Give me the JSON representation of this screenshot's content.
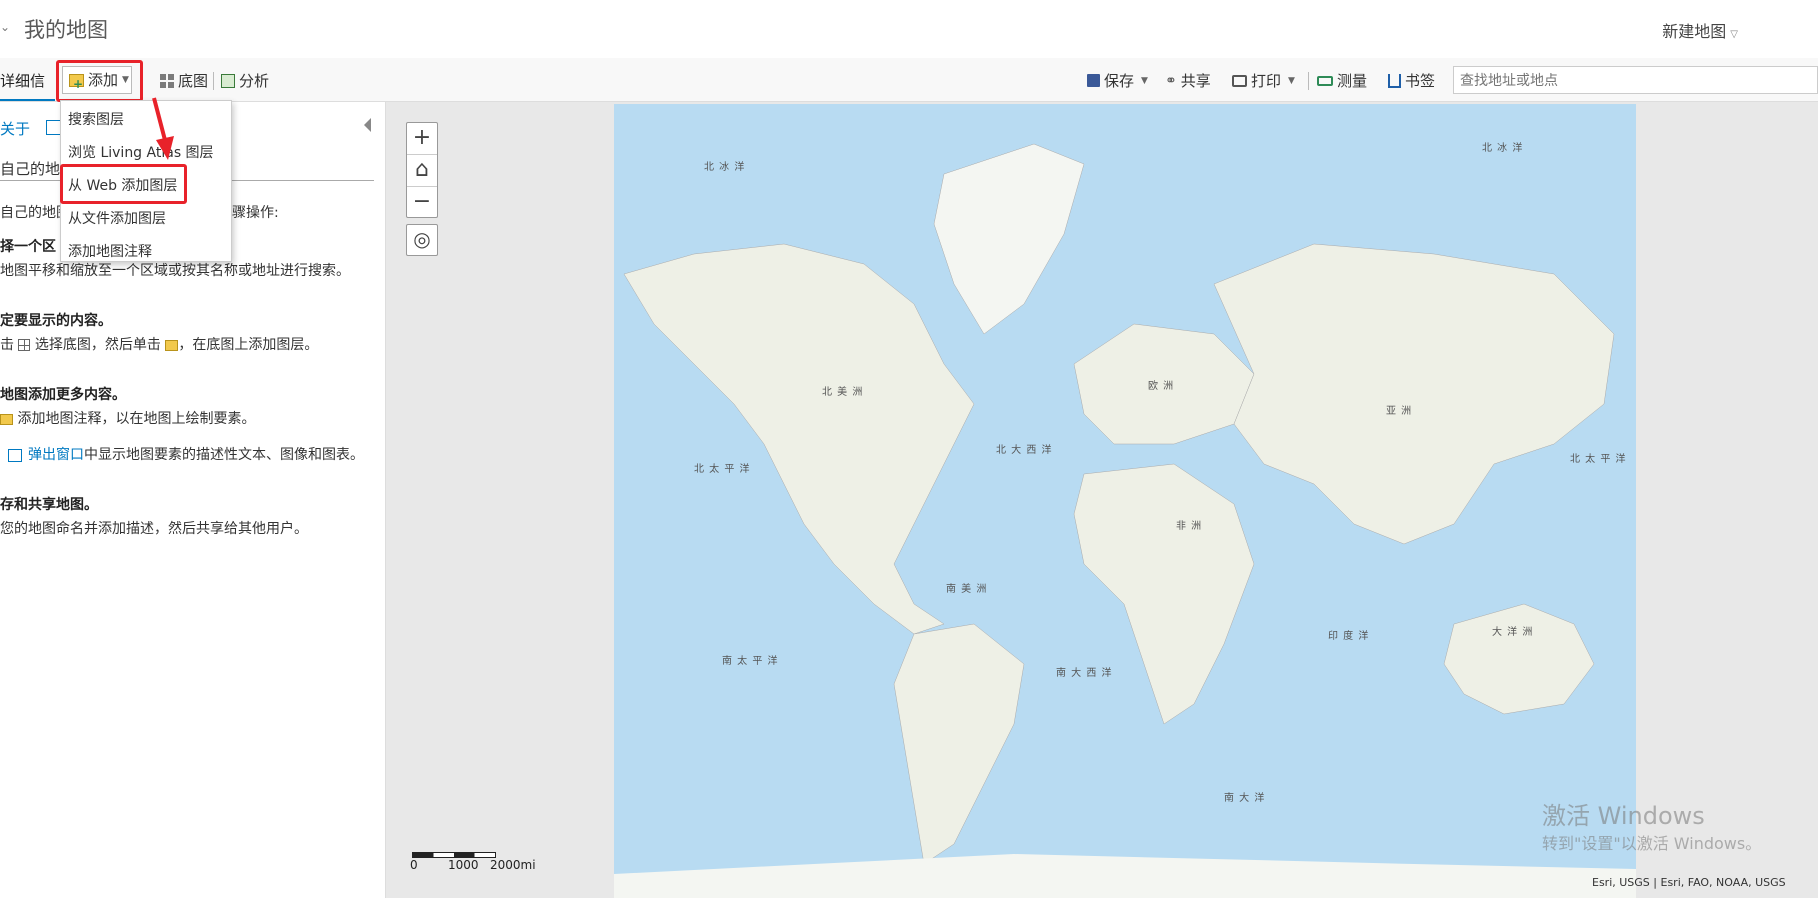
{
  "header": {
    "title": "我的地图",
    "new_map": "新建地图"
  },
  "toolbar": {
    "details_tab": "详细信息",
    "add": "添加",
    "basemap": "底图",
    "analysis": "分析",
    "save": "保存",
    "share": "共享",
    "print": "打印",
    "measure": "测量",
    "bookmarks": "书签",
    "search_placeholder": "查找地址或地点"
  },
  "add_menu": {
    "items": [
      "搜索图层",
      "浏览 Living Atlas 图层",
      "从 Web 添加图层",
      "从文件添加图层",
      "添加地图注释"
    ]
  },
  "panel": {
    "about": "关于",
    "subtitle": "自己的地图",
    "intro": "自己的地图",
    "intro_tail": "骤操作:",
    "step1_title": "择一个区",
    "step1_text": "地图平移和缩放至一个区域或按其名称或地址进行搜索。",
    "step2_title": "定要显示的内容。",
    "step2_text_a": "击",
    "step2_text_b": "选择底图，然后单击",
    "step2_text_c": "，在底图上添加图层。",
    "step3_title": "地图添加更多内容。",
    "step3_text": "添加地图注释，以在地图上绘制要素。",
    "step3_link": "弹出窗口",
    "step3_link_tail": "中显示地图要素的描述性文本、图像和图表。",
    "step4_title": "存和共享地图。",
    "step4_text": "您的地图命名并添加描述，然后共享给其他用户。"
  },
  "map": {
    "labels": {
      "arctic_left": "北 冰 洋",
      "arctic_right": "北 冰 洋",
      "north_america": "北 美 洲",
      "europe": "欧 洲",
      "asia": "亚 洲",
      "north_atlantic": "北 大 西 洋",
      "north_pacific_left": "北 太 平 洋",
      "north_pacific_right": "北 太 平 洋",
      "africa": "非 洲",
      "south_america": "南 美 洲",
      "south_pacific": "南 太 平 洋",
      "south_atlantic": "南 大 西 洋",
      "indian_ocean": "印 度 洋",
      "oceania": "大 洋 洲",
      "southern_ocean": "南 大 洋"
    },
    "scale_0": "0",
    "scale_1000": "1000",
    "scale_2000": "2000mi",
    "attribution": "Esri, USGS | Esri, FAO, NOAA, USGS",
    "zoom_in": "+",
    "zoom_out": "−",
    "home": "⌂",
    "locate": "◎"
  },
  "watermark": {
    "line1": "激活 Windows",
    "line2": "转到\"设置\"以激活 Windows。"
  },
  "colors": {
    "accent": "#0079c1",
    "highlight": "#e8222a",
    "ocean": "#b8dbf2",
    "land": "#eef0e6"
  }
}
